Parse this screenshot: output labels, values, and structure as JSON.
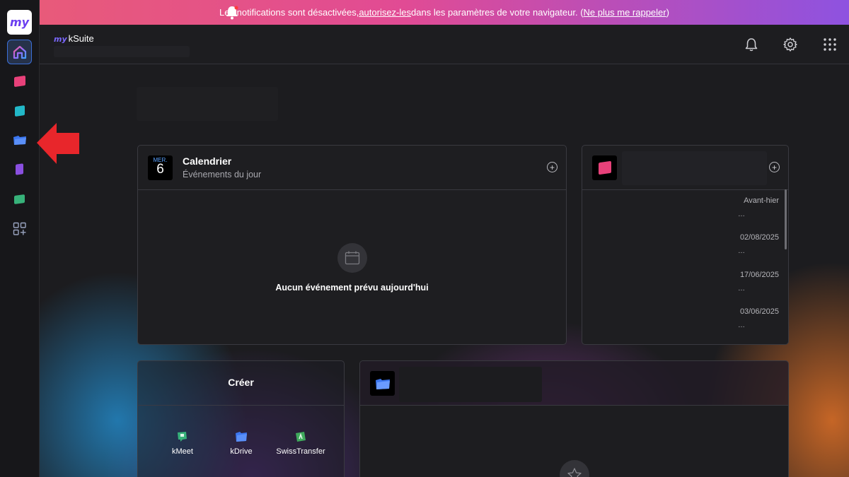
{
  "banner": {
    "text_before": "Les notifications sont désactivées, ",
    "link_allow": "autorisez-les",
    "text_middle": " dans les paramètres de votre navigateur. (",
    "link_dismiss": "Ne plus me rappeler",
    "text_after": ")"
  },
  "rail": {
    "logo": "my",
    "items": [
      {
        "name": "home",
        "color": "#3b6fd8"
      },
      {
        "name": "mail",
        "color": "#e8417a"
      },
      {
        "name": "calendar",
        "color": "#22b8c8"
      },
      {
        "name": "kdrive",
        "color": "#3b76f0"
      },
      {
        "name": "notes",
        "color": "#8a4fe0"
      },
      {
        "name": "kchat",
        "color": "#37b27a"
      },
      {
        "name": "apps-add",
        "color": "#9aa4c0"
      }
    ]
  },
  "header": {
    "brand_prefix": "my",
    "brand_name": "kSuite"
  },
  "calendar_card": {
    "day_of_week": "MER.",
    "day_number": "6",
    "title": "Calendrier",
    "subtitle": "Événements du jour",
    "empty_text": "Aucun événement prévu aujourd'hui"
  },
  "mail_card": {
    "dates": [
      "Avant-hier",
      "02/08/2025",
      "17/06/2025",
      "03/06/2025"
    ]
  },
  "create_card": {
    "title": "Créer",
    "apps": [
      {
        "label": "kMeet",
        "color": "#37b27a"
      },
      {
        "label": "kDrive",
        "color": "#3b76f0"
      },
      {
        "label": "SwissTransfer",
        "color": "#3faa5c"
      }
    ]
  },
  "colors": {
    "accent": "#3b6fd8",
    "arrow": "#e8262b"
  }
}
